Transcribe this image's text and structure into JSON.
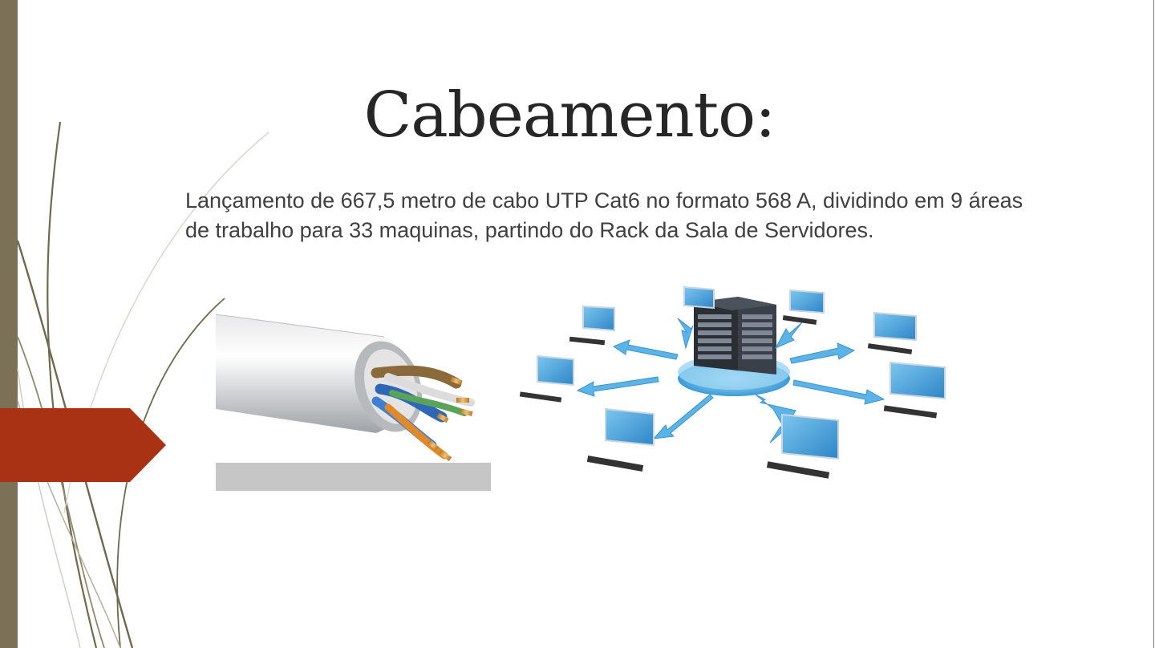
{
  "slide": {
    "title": "Cabeamento:",
    "body": "Lançamento de 667,5 metro de cabo UTP Cat6 no formato 568 A, dividindo em 9 áreas de trabalho para 33 maquinas, partindo do Rack da Sala de Servidores."
  },
  "colors": {
    "left_bar": "#7a7156",
    "accent_arrow": "#a93214",
    "title_text": "#262626",
    "body_text": "#404040",
    "curve": "#6e6a4e",
    "network_blue": "#3a9bd8",
    "arrow_blue": "#5ab4e8"
  },
  "images": {
    "cable": "utp-cat6-cable-illustration",
    "network": "network-server-with-workstations-illustration"
  }
}
